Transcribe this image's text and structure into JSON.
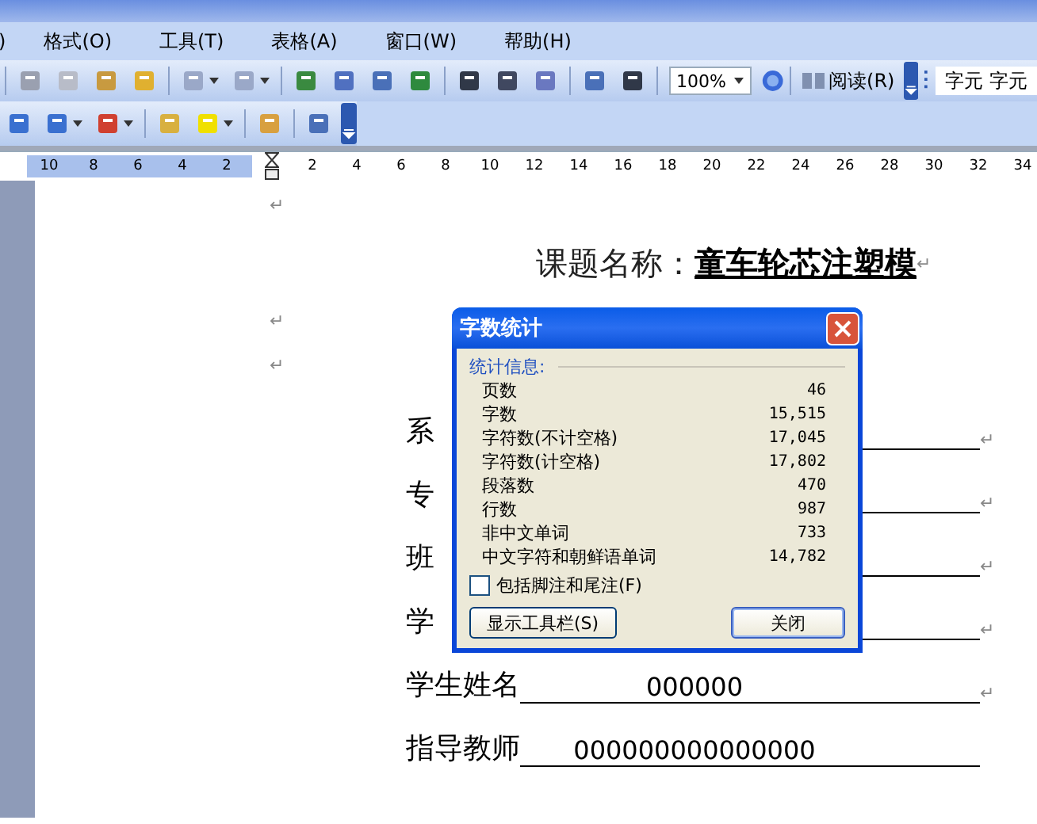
{
  "menu_bar": {
    "items": [
      ")",
      "格式(O)",
      "工具(T)",
      "表格(A)",
      "窗口(W)",
      "帮助(H)"
    ]
  },
  "standard_toolbar": {
    "zoom": "100%",
    "read_button": "阅读(R)",
    "style_box": "字元 字元"
  },
  "ruler": {
    "left_ticks": [
      "10",
      "8",
      "6",
      "4",
      "2"
    ],
    "right_ticks": [
      "2",
      "4",
      "6",
      "8",
      "10",
      "12",
      "14",
      "16",
      "18",
      "20",
      "22",
      "24",
      "26",
      "28",
      "30",
      "32",
      "34"
    ]
  },
  "document": {
    "paragraphs": [
      {
        "kind": "empty",
        "mark": "↵"
      },
      {
        "kind": "title",
        "label": "课题名称：",
        "value": "童车轮芯注塑模",
        "mark": "↵"
      },
      {
        "kind": "empty",
        "mark": "↵"
      },
      {
        "kind": "empty",
        "mark": "↵"
      },
      {
        "kind": "field",
        "label": "系",
        "mark": "↵"
      },
      {
        "kind": "field",
        "label": "专",
        "mark": "↵"
      },
      {
        "kind": "field",
        "label": "班",
        "mark": "↵"
      },
      {
        "kind": "field",
        "label": "学",
        "mark": "↵"
      },
      {
        "kind": "field",
        "label": "学生姓名",
        "value": "000000",
        "mark": "↵"
      },
      {
        "kind": "field",
        "label": "指导教师",
        "value": "000000000000000"
      }
    ]
  },
  "dialog": {
    "title": "字数统计",
    "group": "统计信息:",
    "stats": [
      {
        "label": "页数",
        "value": "46"
      },
      {
        "label": "字数",
        "value": "15,515"
      },
      {
        "label": "字符数(不计空格)",
        "value": "17,045"
      },
      {
        "label": "字符数(计空格)",
        "value": "17,802"
      },
      {
        "label": "段落数",
        "value": "470"
      },
      {
        "label": "行数",
        "value": "987"
      },
      {
        "label": "非中文单词",
        "value": "733"
      },
      {
        "label": "中文字符和朝鲜语单词",
        "value": "14,782"
      }
    ],
    "checkbox": {
      "label": "包括脚注和尾注(F)",
      "checked": false
    },
    "buttons": [
      {
        "label": "显示工具栏(S)",
        "default": false
      },
      {
        "label": "关闭",
        "default": true
      }
    ]
  }
}
